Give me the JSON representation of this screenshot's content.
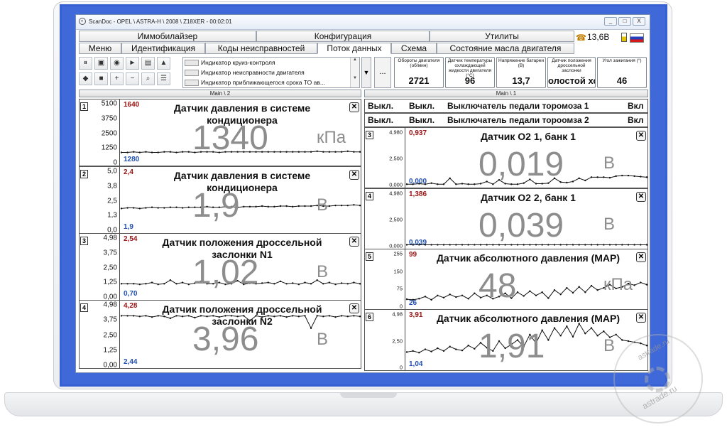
{
  "window": {
    "title": "ScanDoc - OPEL \\ ASTRA-H \\ 2008 \\ Z18XER - 00:02:01",
    "minimize": "_",
    "maximize": "□",
    "close": "X"
  },
  "menu_top": [
    "Иммобилайзер",
    "Конфигурация",
    "Утилиты"
  ],
  "menu_tabs": [
    "Меню",
    "Идентификация",
    "Коды неисправностей",
    "Поток данных",
    "Схема",
    "Состояние масла двигателя"
  ],
  "active_tab": "Поток данных",
  "status": {
    "battery_voltage": "13,6В",
    "phone_icon": "phone-icon",
    "battery_icon": "battery-icon",
    "language_flag": "flag-ru-icon"
  },
  "toolbar": {
    "buttons": [
      {
        "name": "pause-button",
        "glyph": "⏸"
      },
      {
        "name": "save-button",
        "glyph": "▣"
      },
      {
        "name": "record-button",
        "glyph": "◉"
      },
      {
        "name": "play-button",
        "glyph": "►"
      },
      {
        "name": "folder-button",
        "glyph": "▤"
      },
      {
        "name": "graph-button",
        "glyph": "▲"
      },
      {
        "name": "leaf-button",
        "glyph": "◆"
      },
      {
        "name": "stop-button",
        "glyph": "■"
      },
      {
        "name": "zoom-in-button",
        "glyph": "+"
      },
      {
        "name": "zoom-out-button",
        "glyph": "−"
      },
      {
        "name": "zoom-fit-button",
        "glyph": "⌕"
      },
      {
        "name": "list-button",
        "glyph": "☰"
      }
    ]
  },
  "indicators": [
    "Индикатор круиз-контроля",
    "Индикатор неисправности двигателя",
    "Индикатор приближающегося срока ТО ав..."
  ],
  "more_button": "...",
  "params": [
    {
      "label": "Обороты двигателя (об/мин)",
      "value": "2721"
    },
    {
      "label": "Датчик температуры охлаждающей жидкости двигателя (°С)",
      "value": "96"
    },
    {
      "label": "Напряжение батареи (В)",
      "value": "13,7"
    },
    {
      "label": "Датчик положения дроссельной заслонки",
      "value": "олостой хо"
    },
    {
      "label": "Угол зажигания (°)",
      "value": "46"
    }
  ],
  "sections": {
    "left": "Main \\ 2",
    "right": "Main \\ 1"
  },
  "binary_rows": [
    {
      "col1": "Выкл.",
      "col2": "Выкл.",
      "name": "Выключатель педали торомоза 1",
      "state": "Вкл"
    },
    {
      "col1": "Выкл.",
      "col2": "Выкл.",
      "name": "Выключатель педали тороомза 2",
      "state": "Вкл"
    }
  ],
  "left_panels": [
    {
      "num": "1",
      "title": "Датчик давления в системе кондиционера",
      "value": "1340",
      "unit": "кПа",
      "hi": "1640",
      "lo": "1280",
      "ticks": [
        "5100",
        "3750",
        "2500",
        "1250",
        "0"
      ],
      "series": [
        0.17,
        0.17,
        0.18,
        0.17,
        0.18,
        0.17,
        0.17,
        0.18,
        0.18,
        0.17,
        0.18,
        0.18,
        0.17,
        0.18,
        0.18,
        0.18,
        0.17,
        0.18,
        0.18,
        0.18,
        0.18,
        0.18,
        0.18,
        0.18,
        0.18,
        0.18,
        0.18,
        0.18,
        0.18,
        0.18,
        0.18,
        0.18,
        0.19,
        0.18,
        0.18,
        0.18,
        0.18,
        0.19,
        0.18,
        0.18
      ]
    },
    {
      "num": "2",
      "title": "Датчик давления в системе кондиционера",
      "value": "1,9",
      "unit": "В",
      "hi": "2,4",
      "lo": "1,9",
      "ticks": [
        "5,0",
        "3,8",
        "2,5",
        "1,3",
        "0,0"
      ],
      "series": [
        0.36,
        0.37,
        0.37,
        0.36,
        0.37,
        0.38,
        0.37,
        0.37,
        0.38,
        0.38,
        0.37,
        0.38,
        0.38,
        0.38,
        0.39,
        0.38,
        0.38,
        0.39,
        0.39,
        0.38,
        0.39,
        0.39,
        0.39,
        0.4,
        0.39,
        0.39,
        0.4,
        0.4,
        0.39,
        0.4,
        0.4,
        0.4,
        0.41,
        0.4,
        0.4,
        0.41,
        0.41,
        0.41,
        0.42,
        0.41
      ]
    },
    {
      "num": "3",
      "title": "Датчик положения дроссельной заслонки N1",
      "value": "1,02",
      "unit": "В",
      "hi": "2,54",
      "lo": "0,70",
      "ticks": [
        "4,98",
        "3,75",
        "2,50",
        "1,25",
        "0,00"
      ],
      "series": [
        0.22,
        0.22,
        0.22,
        0.21,
        0.22,
        0.24,
        0.21,
        0.22,
        0.28,
        0.22,
        0.24,
        0.21,
        0.23,
        0.26,
        0.22,
        0.22,
        0.24,
        0.21,
        0.22,
        0.27,
        0.21,
        0.23,
        0.22,
        0.23,
        0.24,
        0.22,
        0.26,
        0.22,
        0.23,
        0.21,
        0.24,
        0.22,
        0.28,
        0.22,
        0.24,
        0.21,
        0.23,
        0.22,
        0.24,
        0.22
      ]
    },
    {
      "num": "4",
      "title": "Датчик положения дроссельной заслонки N2",
      "value": "3,96",
      "unit": "В",
      "hi": "4,28",
      "lo": "2,44",
      "ticks": [
        "4,98",
        "3,75",
        "2,50",
        "1,25",
        "0,00"
      ],
      "series": [
        0.8,
        0.8,
        0.8,
        0.79,
        0.8,
        0.78,
        0.8,
        0.79,
        0.76,
        0.8,
        0.79,
        0.8,
        0.77,
        0.8,
        0.79,
        0.8,
        0.78,
        0.8,
        0.8,
        0.79,
        0.8,
        0.72,
        0.8,
        0.78,
        0.8,
        0.79,
        0.8,
        0.78,
        0.8,
        0.79,
        0.8,
        0.6,
        0.8,
        0.79,
        0.8,
        0.78,
        0.8,
        0.79,
        0.8,
        0.79
      ]
    }
  ],
  "right_panels": [
    {
      "num": "3",
      "title": "Датчик O2 1, банк 1",
      "value": "0,019",
      "unit": "В",
      "hi": "0,937",
      "lo": "0,000",
      "ticks": [
        "4,980",
        "2,500",
        "0,000"
      ],
      "series": [
        0.01,
        0.01,
        0.02,
        0.01,
        0.03,
        0.01,
        0.01,
        0.12,
        0.01,
        0.02,
        0.01,
        0.01,
        0.02,
        0.06,
        0.01,
        0.09,
        0.02,
        0.01,
        0.01,
        0.03,
        0.1,
        0.02,
        0.02,
        0.03,
        0.12,
        0.05,
        0.04,
        0.06,
        0.12,
        0.08,
        0.14,
        0.14,
        0.14,
        0.13,
        0.16,
        0.17,
        0.17,
        0.16,
        0.15,
        0.14
      ]
    },
    {
      "num": "4",
      "title": "Датчик O2 2, банк 1",
      "value": "0,039",
      "unit": "В",
      "hi": "1,386",
      "lo": "0,039",
      "ticks": [
        "4,980",
        "2,500",
        "0,000"
      ],
      "series": [
        0.02,
        0.02,
        0.02,
        0.02,
        0.02,
        0.02,
        0.02,
        0.02,
        0.02,
        0.02,
        0.02,
        0.02,
        0.02,
        0.02,
        0.02,
        0.02,
        0.02,
        0.02,
        0.02,
        0.02,
        0.02,
        0.02,
        0.02,
        0.02,
        0.02,
        0.02,
        0.02,
        0.02,
        0.02,
        0.02,
        0.02,
        0.02,
        0.02,
        0.02,
        0.02,
        0.02,
        0.02,
        0.02,
        0.02,
        0.02
      ]
    },
    {
      "num": "5",
      "title": "Датчик абсолютного давления (MAP)",
      "value": "48",
      "unit": "кПа",
      "hi": "99",
      "lo": "26",
      "ticks": [
        "255",
        "150",
        "75",
        "0"
      ],
      "series": [
        0.13,
        0.12,
        0.14,
        0.18,
        0.12,
        0.2,
        0.16,
        0.22,
        0.17,
        0.2,
        0.14,
        0.24,
        0.16,
        0.2,
        0.14,
        0.18,
        0.24,
        0.15,
        0.26,
        0.19,
        0.28,
        0.2,
        0.26,
        0.15,
        0.3,
        0.22,
        0.34,
        0.25,
        0.36,
        0.26,
        0.38,
        0.3,
        0.34,
        0.4,
        0.33,
        0.36,
        0.42,
        0.39,
        0.44,
        0.4
      ]
    },
    {
      "num": "6",
      "title": "Датчик абсолютного давления (MAP)",
      "value": "1,91",
      "unit": "В",
      "hi": "3,91",
      "lo": "1,04",
      "ticks": [
        "4,98",
        "2,50",
        "0"
      ],
      "series": [
        0.28,
        0.3,
        0.27,
        0.33,
        0.29,
        0.35,
        0.3,
        0.38,
        0.33,
        0.31,
        0.4,
        0.34,
        0.45,
        0.36,
        0.3,
        0.48,
        0.35,
        0.42,
        0.5,
        0.38,
        0.6,
        0.44,
        0.68,
        0.5,
        0.72,
        0.58,
        0.75,
        0.56,
        0.8,
        0.62,
        0.72,
        0.58,
        0.66,
        0.55,
        0.6,
        0.5,
        0.48,
        0.46,
        0.44,
        0.4
      ]
    }
  ],
  "watermark": {
    "text1": "astrade.ru",
    "text2": "astrade.ru"
  }
}
